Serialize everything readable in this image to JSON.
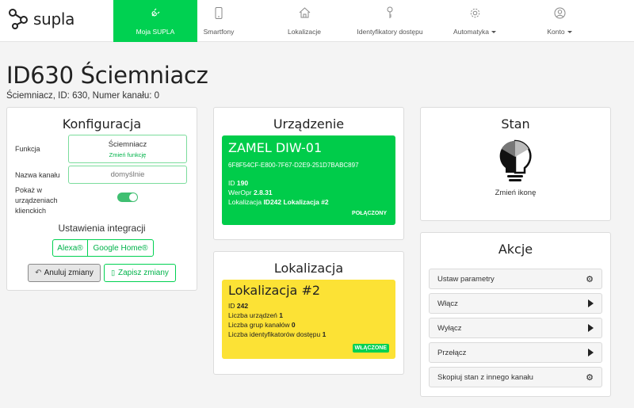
{
  "app": {
    "brand": "supla",
    "accent": "#00d151"
  },
  "nav": [
    {
      "label": "Moja SUPLA",
      "icon": "plug-icon",
      "active": true
    },
    {
      "label": "Smartfony",
      "icon": "phone-icon"
    },
    {
      "label": "Lokalizacje",
      "icon": "home-icon"
    },
    {
      "label": "Identyfikatory dostępu",
      "icon": "key-icon"
    },
    {
      "label": "Automatyka",
      "icon": "gear-icon",
      "dropdown": true
    },
    {
      "label": "Konto",
      "icon": "user-icon",
      "dropdown": true
    }
  ],
  "page": {
    "title": "ID630 Ściemniacz",
    "subtitle": "Ściemniacz, ID: 630, Numer kanału: 0"
  },
  "config": {
    "title": "Konfiguracja",
    "function_label": "Funkcja",
    "function_value": "Ściemniacz",
    "function_change": "Zmień funkcję",
    "name_label": "Nazwa kanału",
    "name_placeholder": "domyślnie",
    "show_label_1": "Pokaż w",
    "show_label_2": "urządzeniach",
    "show_label_3": "klienckich",
    "show_enabled": true,
    "integrations_title": "Ustawienia integracji",
    "alexa": "Alexa®",
    "google_home": "Google Home®",
    "cancel": "Anuluj zmiany",
    "save": "Zapisz zmiany"
  },
  "device": {
    "title": "Urządzenie",
    "name": "ZAMEL DIW-01",
    "guid": "6F8F54CF-E800-7F67-D2E9-251D7BABC897",
    "id_label": "ID",
    "id_value": "190",
    "firmware_label": "WerOpr",
    "firmware_value": "2.8.31",
    "location_label": "Lokalizacja",
    "location_value": "ID242 Lokalizacja #2",
    "status": "POŁĄCZONY",
    "color": "#00cc4a"
  },
  "location": {
    "title": "Lokalizacja",
    "name": "Lokalizacja #2",
    "id_label": "ID",
    "id_value": "242",
    "devices_label": "Liczba urządzeń",
    "devices_value": "1",
    "groups_label": "Liczba grup kanałów",
    "groups_value": "0",
    "ids_label": "Liczba identyfikatorów dostępu",
    "ids_value": "1",
    "status": "WŁĄCZONE",
    "color": "#fce235"
  },
  "state": {
    "title": "Stan",
    "change_icon": "Zmień ikonę",
    "icon": "lightbulb-icon"
  },
  "actions": {
    "title": "Akcje",
    "items": [
      {
        "label": "Ustaw parametry",
        "icon": "gear-icon"
      },
      {
        "label": "Włącz",
        "icon": "play-icon"
      },
      {
        "label": "Wyłącz",
        "icon": "play-icon"
      },
      {
        "label": "Przełącz",
        "icon": "play-icon"
      },
      {
        "label": "Skopiuj stan z innego kanału",
        "icon": "gear-icon"
      }
    ]
  }
}
